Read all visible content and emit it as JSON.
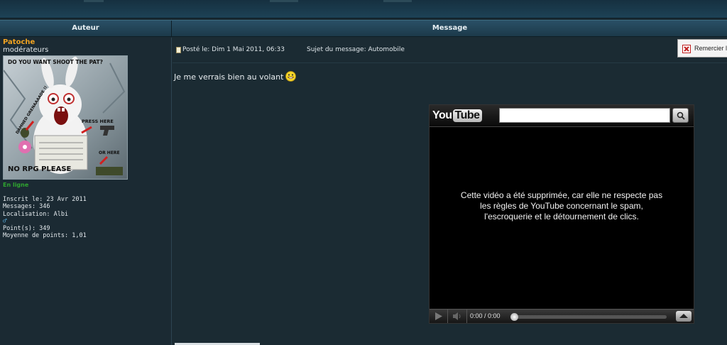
{
  "columns": {
    "author": "Auteur",
    "message": "Message"
  },
  "author": {
    "username": "Patoche",
    "rank": "modérateurs",
    "avatar_text": {
      "top": "DO YOU WANT SHOOT THE PAT?",
      "side": "DAMNED GRENAAAADE !!",
      "press": "PRESS HERE",
      "or": "OR HERE",
      "bottom": "NO RPG PLEASE"
    },
    "status": "En ligne",
    "stats": {
      "joined": "Inscrit le: 23 Avr 2011",
      "messages": "Messages: 346",
      "location": "Localisation: Albi",
      "gender_icon": "male-symbol-icon",
      "points": "Point(s): 349",
      "avg_points": "Moyenne de points: 1,01"
    }
  },
  "post": {
    "posted": "Posté le: Dim 1 Mai 2011, 06:33",
    "subject": "Sujet du message: Automobile",
    "thank_label": "Remercier l",
    "body": "Je me verrais bien au volant",
    "smiley_icon": "grin-smiley-icon"
  },
  "video": {
    "logo_you": "You",
    "logo_tube": "Tube",
    "search_value": "",
    "message_lines": [
      "Cette vidéo a été supprimée, car elle ne respecte pas",
      "les règles de YouTube concernant le spam,",
      "l'escroquerie et le détournement de clics."
    ],
    "time": "0:00 / 0:00",
    "progress": 0
  },
  "colors": {
    "username": "#f0a321",
    "online": "#2fa52f",
    "header_bg": "#234759",
    "page_bg": "#1b2b33"
  }
}
